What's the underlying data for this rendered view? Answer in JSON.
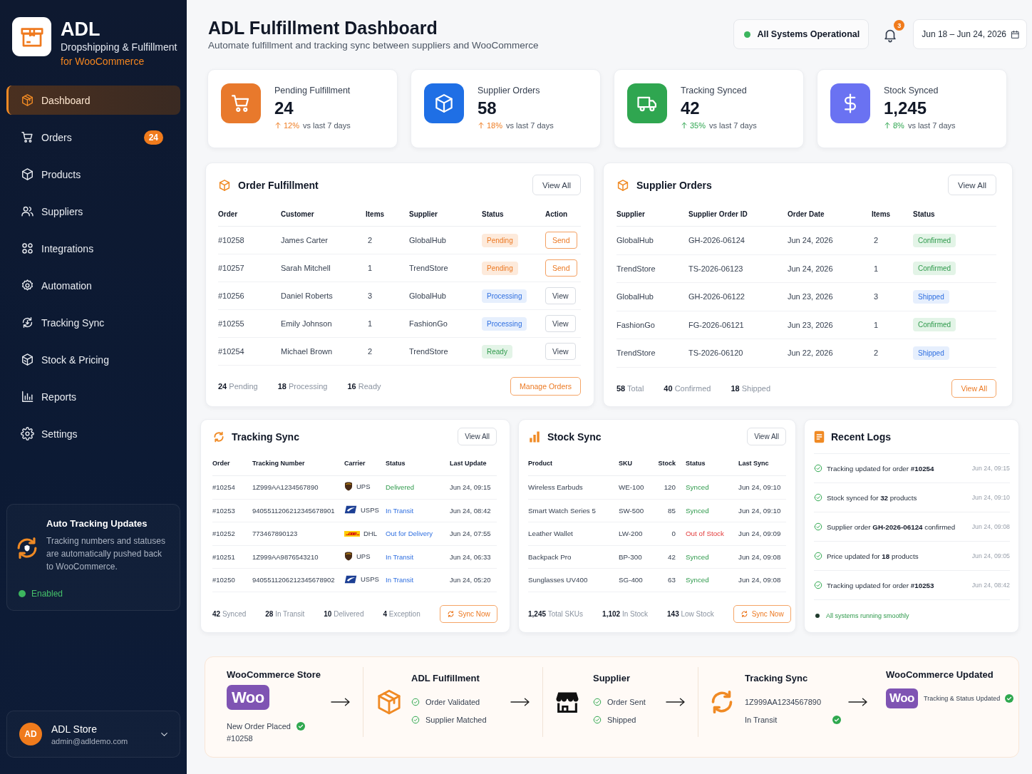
{
  "sidebar": {
    "brand": {
      "name": "ADL",
      "subtitle": "Dropshipping & Fulfillment",
      "tagline": "for WooCommerce"
    },
    "nav": [
      {
        "label": "Dashboard",
        "selected": true
      },
      {
        "label": "Orders",
        "selected": false,
        "badge": "24"
      },
      {
        "label": "Products",
        "selected": false
      },
      {
        "label": "Suppliers",
        "selected": false
      },
      {
        "label": "Integrations",
        "selected": false
      },
      {
        "label": "Automation",
        "selected": false
      },
      {
        "label": "Tracking Sync",
        "selected": false
      },
      {
        "label": "Stock & Pricing",
        "selected": false
      },
      {
        "label": "Reports",
        "selected": false
      },
      {
        "label": "Settings",
        "selected": false
      }
    ],
    "auto_tracking": {
      "title": "Auto Tracking Updates",
      "description": "Tracking numbers and statuses are automatically pushed back to WooCommerce.",
      "status": "Enabled",
      "enabled": true
    },
    "account": {
      "initials": "AD",
      "name": "ADL Store",
      "email": "admin@adldemo.com"
    }
  },
  "header": {
    "title": "ADL Fulfillment Dashboard",
    "subtitle": "Automate fulfillment and tracking sync between suppliers and WooCommerce",
    "system_status": {
      "label": "All Systems Operational",
      "operational": true
    },
    "notifications": {
      "count": "3"
    },
    "date_range": "Jun 18 – Jun 24, 2026"
  },
  "stat_cards": [
    {
      "label": "Pending Fulfillment",
      "value": "24",
      "trend": {
        "text": "12%",
        "kind": "warning"
      },
      "period": "vs last 7 days",
      "color": "#e8792c"
    },
    {
      "label": "Supplier Orders",
      "value": "58",
      "trend": {
        "text": "18%",
        "kind": "warning"
      },
      "period": "vs last 7 days",
      "color": "#1f6fe5"
    },
    {
      "label": "Tracking Synced",
      "value": "42",
      "trend": {
        "text": "35%",
        "kind": "positive"
      },
      "period": "vs last 7 days",
      "color": "#2fa650"
    },
    {
      "label": "Stock Synced",
      "value": "1,245",
      "trend": {
        "text": "8%",
        "kind": "positive"
      },
      "period": "vs last 7 days",
      "color": "#6a72f2"
    }
  ],
  "order_fulfillment": {
    "title": "Order Fulfillment",
    "view_all": "View All",
    "columns": [
      "Order",
      "Customer",
      "Items",
      "Supplier",
      "Status",
      "Action"
    ],
    "rows": [
      {
        "order": "#10258",
        "customer": "James Carter",
        "items": "2",
        "supplier": "GlobalHub",
        "status": {
          "text": "Pending",
          "kind": "pending"
        },
        "action": {
          "label": "Send",
          "kind": "primary"
        }
      },
      {
        "order": "#10257",
        "customer": "Sarah Mitchell",
        "items": "1",
        "supplier": "TrendStore",
        "status": {
          "text": "Pending",
          "kind": "pending"
        },
        "action": {
          "label": "Send",
          "kind": "primary"
        }
      },
      {
        "order": "#10256",
        "customer": "Daniel Roberts",
        "items": "3",
        "supplier": "GlobalHub",
        "status": {
          "text": "Processing",
          "kind": "processing"
        },
        "action": {
          "label": "View",
          "kind": "secondary"
        }
      },
      {
        "order": "#10255",
        "customer": "Emily Johnson",
        "items": "1",
        "supplier": "FashionGo",
        "status": {
          "text": "Processing",
          "kind": "processing"
        },
        "action": {
          "label": "View",
          "kind": "secondary"
        }
      },
      {
        "order": "#10254",
        "customer": "Michael Brown",
        "items": "2",
        "supplier": "TrendStore",
        "status": {
          "text": "Ready",
          "kind": "ready"
        },
        "action": {
          "label": "View",
          "kind": "secondary"
        }
      }
    ],
    "summary": [
      {
        "value": "24",
        "label": "Pending"
      },
      {
        "value": "18",
        "label": "Processing"
      },
      {
        "value": "16",
        "label": "Ready"
      }
    ],
    "button": "Manage Orders"
  },
  "supplier_orders": {
    "title": "Supplier Orders",
    "view_all": "View All",
    "columns": [
      "Supplier",
      "Supplier Order ID",
      "Order Date",
      "Items",
      "Status"
    ],
    "rows": [
      {
        "supplier": "GlobalHub",
        "order_id": "GH-2026-06124",
        "date": "Jun 24, 2026",
        "items": "2",
        "status": {
          "text": "Confirmed",
          "kind": "confirmed"
        }
      },
      {
        "supplier": "TrendStore",
        "order_id": "TS-2026-06123",
        "date": "Jun 24, 2026",
        "items": "1",
        "status": {
          "text": "Confirmed",
          "kind": "confirmed"
        }
      },
      {
        "supplier": "GlobalHub",
        "order_id": "GH-2026-06122",
        "date": "Jun 23, 2026",
        "items": "3",
        "status": {
          "text": "Shipped",
          "kind": "shipped"
        }
      },
      {
        "supplier": "FashionGo",
        "order_id": "FG-2026-06121",
        "date": "Jun 23, 2026",
        "items": "1",
        "status": {
          "text": "Confirmed",
          "kind": "confirmed"
        }
      },
      {
        "supplier": "TrendStore",
        "order_id": "TS-2026-06120",
        "date": "Jun 22, 2026",
        "items": "2",
        "status": {
          "text": "Shipped",
          "kind": "shipped"
        }
      }
    ],
    "summary": [
      {
        "value": "58",
        "label": "Total"
      },
      {
        "value": "40",
        "label": "Confirmed"
      },
      {
        "value": "18",
        "label": "Shipped"
      }
    ],
    "button": "View All"
  },
  "tracking_sync": {
    "title": "Tracking Sync",
    "view_all": "View All",
    "columns": [
      "Order",
      "Tracking Number",
      "Carrier",
      "Status",
      "Last Update"
    ],
    "rows": [
      {
        "order": "#10254",
        "tracking": "1Z999AA1234567890",
        "carrier": {
          "name": "UPS",
          "kind": "ups"
        },
        "status": {
          "text": "Delivered",
          "kind": "delivered"
        },
        "updated": "Jun 24, 09:15"
      },
      {
        "order": "#10253",
        "tracking": "9405511206212345678901",
        "carrier": {
          "name": "USPS",
          "kind": "usps"
        },
        "status": {
          "text": "In Transit",
          "kind": "in_transit"
        },
        "updated": "Jun 24, 08:42"
      },
      {
        "order": "#10252",
        "tracking": "773467890123",
        "carrier": {
          "name": "DHL",
          "kind": "dhl"
        },
        "status": {
          "text": "Out for Delivery",
          "kind": "out_for_delivery"
        },
        "updated": "Jun 24, 07:55"
      },
      {
        "order": "#10251",
        "tracking": "1Z999AA9876543210",
        "carrier": {
          "name": "UPS",
          "kind": "ups"
        },
        "status": {
          "text": "In Transit",
          "kind": "in_transit"
        },
        "updated": "Jun 24, 06:33"
      },
      {
        "order": "#10250",
        "tracking": "9405511206212345678902",
        "carrier": {
          "name": "USPS",
          "kind": "usps"
        },
        "status": {
          "text": "In Transit",
          "kind": "in_transit"
        },
        "updated": "Jun 24, 05:20"
      }
    ],
    "summary": [
      {
        "value": "42",
        "label": "Synced"
      },
      {
        "value": "28",
        "label": "In Transit"
      },
      {
        "value": "10",
        "label": "Delivered"
      },
      {
        "value": "4",
        "label": "Exception"
      }
    ],
    "button": "Sync Now"
  },
  "stock_sync": {
    "title": "Stock Sync",
    "view_all": "View All",
    "columns": [
      "Product",
      "SKU",
      "Stock",
      "Status",
      "Last Sync"
    ],
    "rows": [
      {
        "product": "Wireless Earbuds",
        "sku": "WE-100",
        "stock": "120",
        "status": {
          "text": "Synced",
          "kind": "synced"
        },
        "synced": "Jun 24, 09:10"
      },
      {
        "product": "Smart Watch Series 5",
        "sku": "SW-500",
        "stock": "85",
        "status": {
          "text": "Synced",
          "kind": "synced"
        },
        "synced": "Jun 24, 09:10"
      },
      {
        "product": "Leather Wallet",
        "sku": "LW-200",
        "stock": "0",
        "status": {
          "text": "Out of Stock",
          "kind": "out_of_stock"
        },
        "synced": "Jun 24, 09:09"
      },
      {
        "product": "Backpack Pro",
        "sku": "BP-300",
        "stock": "42",
        "status": {
          "text": "Synced",
          "kind": "synced"
        },
        "synced": "Jun 24, 09:08"
      },
      {
        "product": "Sunglasses UV400",
        "sku": "SG-400",
        "stock": "63",
        "status": {
          "text": "Synced",
          "kind": "synced"
        },
        "synced": "Jun 24, 09:08"
      }
    ],
    "summary": [
      {
        "value": "1,245",
        "label": "Total SKUs"
      },
      {
        "value": "1,102",
        "label": "In Stock"
      },
      {
        "value": "143",
        "label": "Low Stock"
      }
    ],
    "button": "Sync Now"
  },
  "recent_logs": {
    "title": "Recent Logs",
    "entries": [
      {
        "message": "Tracking updated for order **#10254**",
        "time": "Jun 24, 09:15"
      },
      {
        "message": "Stock synced for **32** products",
        "time": "Jun 24, 09:10"
      },
      {
        "message": "Supplier order **GH-2026-06124** confirmed",
        "time": "Jun 24, 09:08"
      },
      {
        "message": "Price updated for **18** products",
        "time": "Jun 24, 09:05"
      },
      {
        "message": "Tracking updated for order **#10253**",
        "time": "Jun 24, 08:42"
      }
    ],
    "footer": "All systems running smoothly"
  },
  "workflow": {
    "steps": [
      {
        "kind": "store",
        "title": "WooCommerce Store",
        "logo_text": "Woo",
        "lines": [
          {
            "text": "New Order Placed",
            "checked": true
          },
          {
            "text": "#10258",
            "checked": false
          }
        ]
      },
      {
        "kind": "fulfillment",
        "title": "ADL Fulfillment",
        "lines": [
          {
            "text": "Order Validated",
            "checked": true
          },
          {
            "text": "Supplier Matched",
            "checked": true
          }
        ]
      },
      {
        "kind": "supplier",
        "title": "Supplier",
        "lines": [
          {
            "text": "Order Sent",
            "checked": true
          },
          {
            "text": "Shipped",
            "checked": true
          }
        ]
      },
      {
        "kind": "tracking",
        "title": "Tracking Sync",
        "lines": [
          {
            "text": "1Z999AA1234567890",
            "checked": false
          },
          {
            "text": "In Transit",
            "checked": true
          }
        ]
      },
      {
        "kind": "destination",
        "title": "WooCommerce Updated",
        "logo_text": "Woo",
        "lines": [
          {
            "text": "Tracking & Status Updated",
            "checked": true
          }
        ]
      }
    ]
  }
}
